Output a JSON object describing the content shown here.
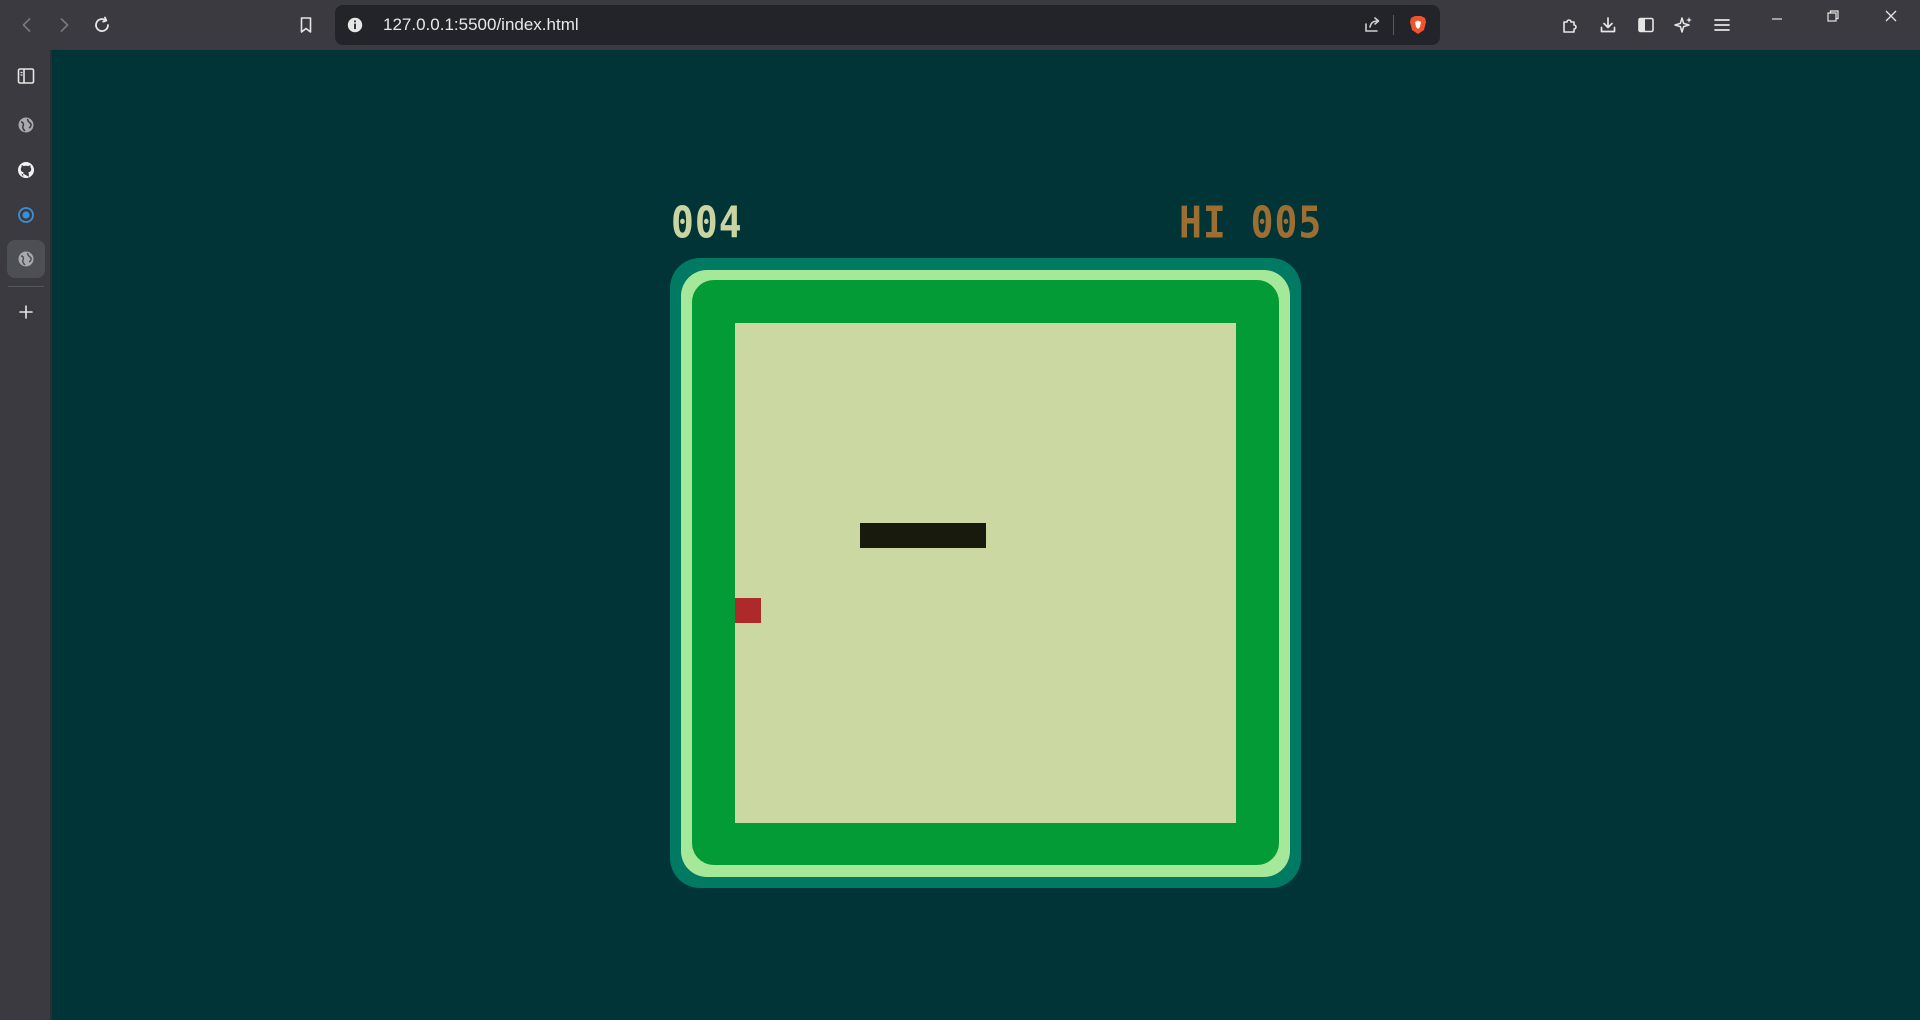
{
  "browser": {
    "url": "127.0.0.1:5500/index.html",
    "icons": {
      "back": "back-arrow-icon",
      "forward": "forward-arrow-icon",
      "reload": "reload-icon",
      "bookmark": "bookmark-icon",
      "site_info": "info-icon",
      "share": "share-icon",
      "shields": "brave-shields-icon",
      "extensions": "puzzle-icon",
      "downloads": "download-icon",
      "sidebar_toggle": "sidebar-toggle-icon",
      "leo": "sparkle-icon",
      "menu": "hamburger-icon",
      "minimize": "minimize-icon",
      "restore": "restore-icon",
      "close": "close-icon"
    }
  },
  "sidebar": {
    "items": [
      {
        "icon": "sidebar-panel-icon"
      },
      {
        "icon": "globe-icon"
      },
      {
        "icon": "github-icon"
      },
      {
        "icon": "circle-dot-icon"
      },
      {
        "icon": "globe-icon"
      },
      {
        "icon": "plus-icon"
      }
    ]
  },
  "game": {
    "score": "004",
    "high_score": "HI 005",
    "grid": {
      "cols": 20,
      "rows": 20
    },
    "snake": [
      {
        "x": 5,
        "y": 8
      },
      {
        "x": 6,
        "y": 8
      },
      {
        "x": 7,
        "y": 8
      },
      {
        "x": 8,
        "y": 8
      },
      {
        "x": 9,
        "y": 8
      }
    ],
    "food": {
      "x": 0,
      "y": 11
    },
    "colors": {
      "background": "#003436",
      "score": "#c9d4a0",
      "high_score": "#9d6e32",
      "console_outer": "#007a62",
      "console_ring": "#a6e89a",
      "console_inner": "#039b35",
      "board": "#cbd8a2",
      "snake": "#181a0e",
      "food": "#ae2a2a"
    }
  }
}
